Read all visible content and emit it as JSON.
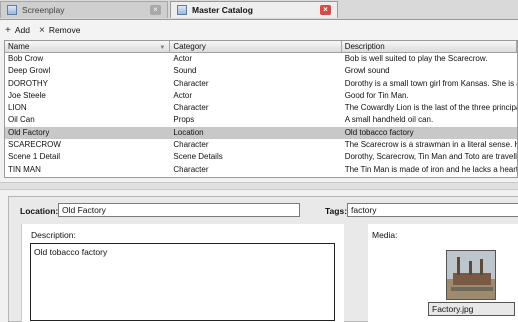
{
  "tabs": [
    {
      "label": "Screenplay",
      "close": "×"
    },
    {
      "label": "Master Catalog",
      "close": "×"
    }
  ],
  "toolbar": {
    "add_label": "Add",
    "add_icon": "+",
    "remove_label": "Remove",
    "remove_icon": "×"
  },
  "grid": {
    "columns": [
      "Name",
      "Category",
      "Description"
    ],
    "filter_icon": "▼",
    "rows": [
      [
        "Bob Crow",
        "Actor",
        "Bob is well suited to play the Scarecrow."
      ],
      [
        "Deep Growl",
        "Sound",
        "Growl sound"
      ],
      [
        "DOROTHY",
        "Character",
        "Dorothy is a small town girl from Kansas. She is an o..."
      ],
      [
        "Joe Steele",
        "Actor",
        "Good for Tin Man."
      ],
      [
        "LION",
        "Character",
        "The Cowardly Lion is the last of the three principal c..."
      ],
      [
        "Oil Can",
        "Props",
        "A small handheld oil can."
      ],
      [
        "Old Factory",
        "Location",
        "Old tobacco factory"
      ],
      [
        "SCARECROW",
        "Character",
        "The Scarecrow is a strawman in a literal sense. He ..."
      ],
      [
        "Scene 1 Detail",
        "Scene Details",
        "Dorothy, Scarecrow, Tin Man and Toto are travellin..."
      ],
      [
        "TIN MAN",
        "Character",
        "The Tin Man is made of iron and he lacks a heart. H..."
      ]
    ],
    "selected_index": 6
  },
  "detail": {
    "location_label": "Location:",
    "location_value": "Old Factory",
    "tags_label": "Tags:",
    "tags_value": "factory",
    "description_label": "Description:",
    "description_value": "Old tobacco factory",
    "media_label": "Media:",
    "media_caption": "Factory.jpg"
  }
}
